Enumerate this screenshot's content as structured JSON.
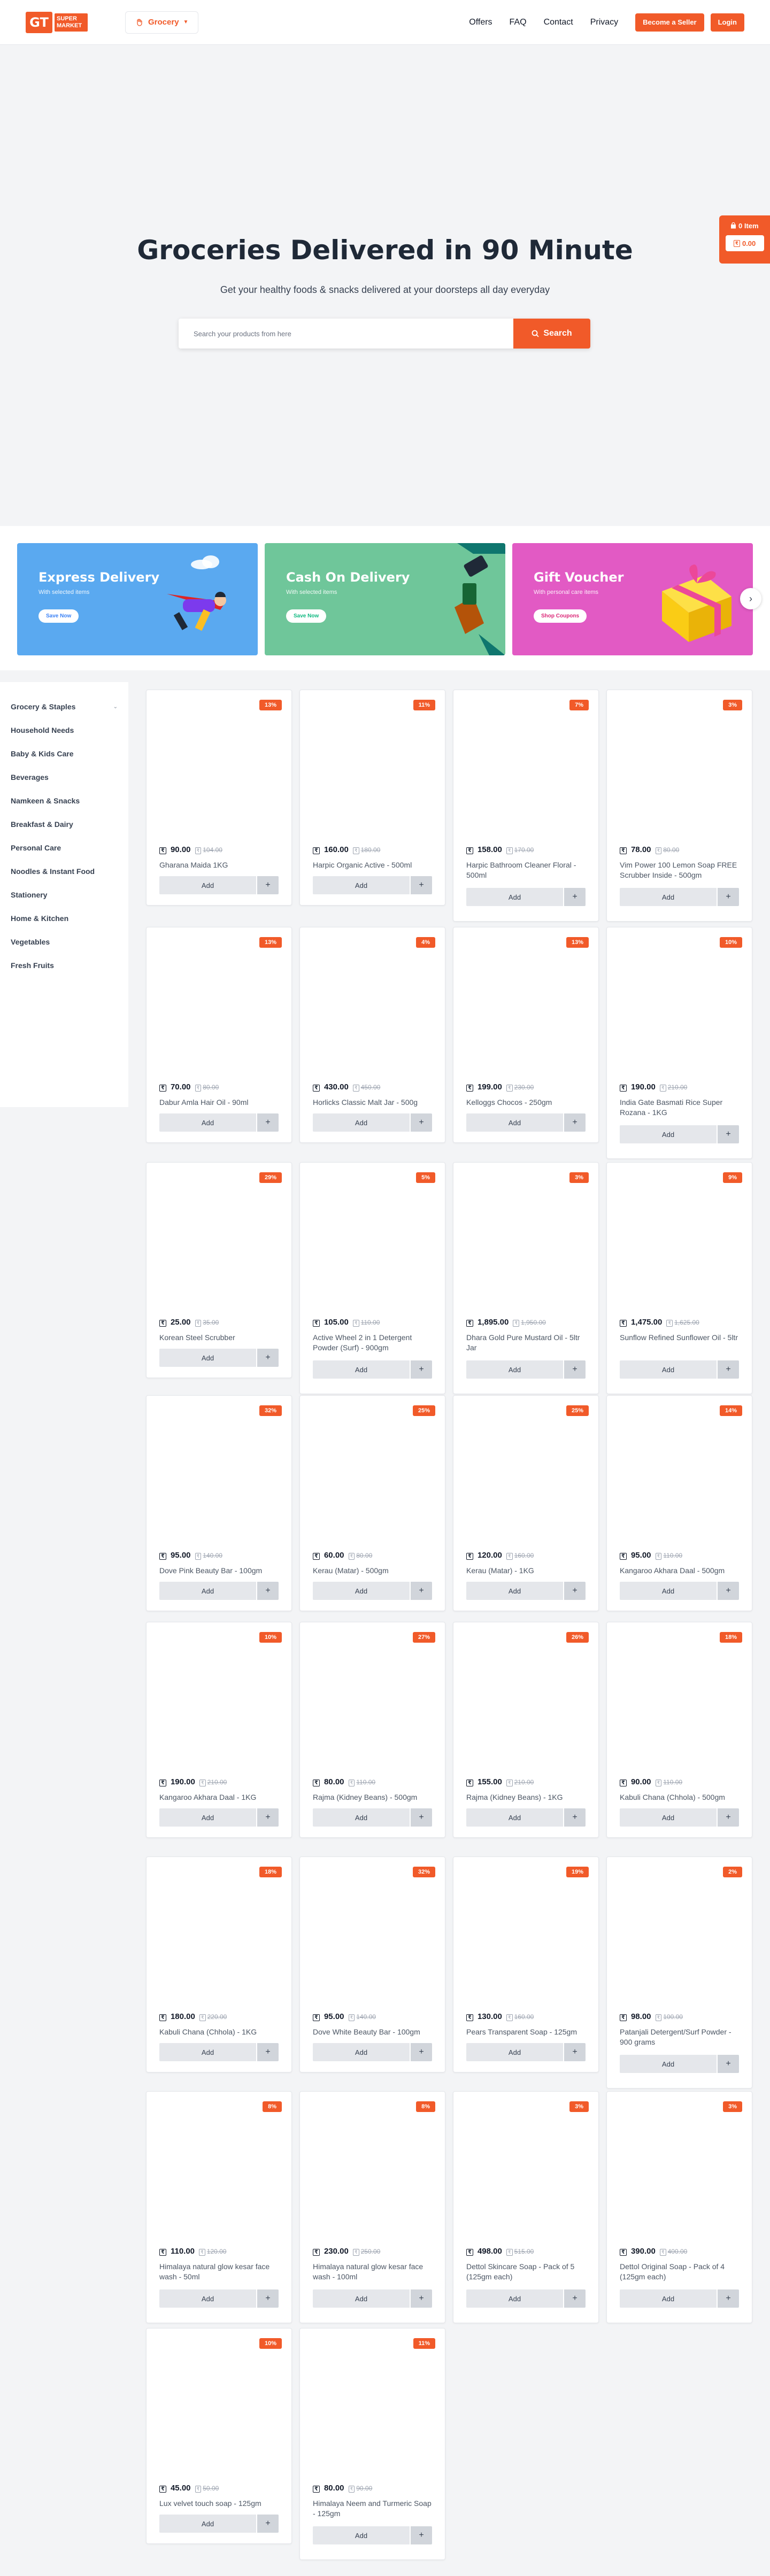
{
  "header": {
    "logo_mark": "GT",
    "logo_text": "SUPER MARKET",
    "category_selector": "Grocery",
    "nav": [
      "Offers",
      "FAQ",
      "Contact",
      "Privacy"
    ],
    "seller_button": "Become a Seller",
    "login_button": "Login"
  },
  "hero": {
    "title": "Groceries Delivered in 90 Minute",
    "subtitle": "Get your healthy foods & snacks delivered at your doorsteps all day everyday",
    "search_placeholder": "Search your products from here",
    "search_button": "Search"
  },
  "cart": {
    "items_label": "0 Item",
    "amount": "0.00",
    "currency_icon": "rupee-icon"
  },
  "promos": [
    {
      "title": "Express Delivery",
      "text": "With selected items",
      "button": "Save Now",
      "bg": "#5aa9f0",
      "accent": "#3b82f6"
    },
    {
      "title": "Cash On Delivery",
      "text": "With selected items",
      "button": "Save Now",
      "bg": "#6fc69a",
      "accent": "#10b981"
    },
    {
      "title": "Gift Voucher",
      "text": "With personal care items",
      "button": "Shop Coupons",
      "bg": "#e25ac4",
      "accent": "#db2777"
    }
  ],
  "sidebar": {
    "items": [
      "Grocery & Staples",
      "Household Needs",
      "Baby & Kids Care",
      "Beverages",
      "Namkeen & Snacks",
      "Breakfast & Dairy",
      "Personal Care",
      "Noodles & Instant Food",
      "Stationery",
      "Home & Kitchen",
      "Vegetables",
      "Fresh Fruits"
    ]
  },
  "labels": {
    "add": "Add",
    "plus": "+"
  },
  "products": [
    {
      "name": "Gharana Maida 1KG",
      "price": "90.00",
      "old": "104.00",
      "discount": "13%"
    },
    {
      "name": "Harpic Organic Active - 500ml",
      "price": "160.00",
      "old": "180.00",
      "discount": "11%"
    },
    {
      "name": "Harpic Bathroom Cleaner Floral - 500ml",
      "price": "158.00",
      "old": "170.00",
      "discount": "7%"
    },
    {
      "name": "Vim Power 100 Lemon Soap FREE Scrubber Inside - 500gm",
      "price": "78.00",
      "old": "80.00",
      "discount": "3%"
    },
    {
      "name": "Dabur Amla Hair Oil - 90ml",
      "price": "70.00",
      "old": "80.00",
      "discount": "13%"
    },
    {
      "name": "Horlicks Classic Malt Jar - 500g",
      "price": "430.00",
      "old": "450.00",
      "discount": "4%"
    },
    {
      "name": "Kelloggs Chocos - 250gm",
      "price": "199.00",
      "old": "230.00",
      "discount": "13%"
    },
    {
      "name": "India Gate Basmati Rice Super Rozana - 1KG",
      "price": "190.00",
      "old": "210.00",
      "discount": "10%"
    },
    {
      "name": "Korean Steel Scrubber",
      "price": "25.00",
      "old": "35.00",
      "discount": "29%"
    },
    {
      "name": "Active Wheel 2 in 1 Detergent Powder (Surf) - 900gm",
      "price": "105.00",
      "old": "110.00",
      "discount": "5%"
    },
    {
      "name": "Dhara Gold Pure Mustard Oil - 5ltr Jar",
      "price": "1,895.00",
      "old": "1,950.00",
      "discount": "3%"
    },
    {
      "name": "Sunflow Refined Sunflower Oil - 5ltr",
      "price": "1,475.00",
      "old": "1,625.00",
      "discount": "9%"
    },
    {
      "name": "Dove Pink Beauty Bar - 100gm",
      "price": "95.00",
      "old": "140.00",
      "discount": "32%"
    },
    {
      "name": "Kerau (Matar) - 500gm",
      "price": "60.00",
      "old": "80.00",
      "discount": "25%"
    },
    {
      "name": "Kerau (Matar) - 1KG",
      "price": "120.00",
      "old": "160.00",
      "discount": "25%"
    },
    {
      "name": "Kangaroo Akhara Daal - 500gm",
      "price": "95.00",
      "old": "110.00",
      "discount": "14%"
    },
    {
      "name": "Kangaroo Akhara Daal - 1KG",
      "price": "190.00",
      "old": "210.00",
      "discount": "10%"
    },
    {
      "name": "Rajma (Kidney Beans) - 500gm",
      "price": "80.00",
      "old": "110.00",
      "discount": "27%"
    },
    {
      "name": "Rajma (Kidney Beans) - 1KG",
      "price": "155.00",
      "old": "210.00",
      "discount": "26%"
    },
    {
      "name": "Kabuli Chana (Chhola) - 500gm",
      "price": "90.00",
      "old": "110.00",
      "discount": "18%"
    },
    {
      "name": "Kabuli Chana (Chhola) - 1KG",
      "price": "180.00",
      "old": "220.00",
      "discount": "18%"
    },
    {
      "name": "Dove White Beauty Bar - 100gm",
      "price": "95.00",
      "old": "140.00",
      "discount": "32%"
    },
    {
      "name": "Pears Transparent Soap - 125gm",
      "price": "130.00",
      "old": "160.00",
      "discount": "19%"
    },
    {
      "name": "Patanjali Detergent/Surf Powder - 900 grams",
      "price": "98.00",
      "old": "100.00",
      "discount": "2%"
    },
    {
      "name": "Himalaya natural glow kesar face wash - 50ml",
      "price": "110.00",
      "old": "120.00",
      "discount": "8%"
    },
    {
      "name": "Himalaya natural glow kesar face wash - 100ml",
      "price": "230.00",
      "old": "250.00",
      "discount": "8%"
    },
    {
      "name": "Dettol Skincare Soap - Pack of 5 (125gm each)",
      "price": "498.00",
      "old": "515.00",
      "discount": "3%"
    },
    {
      "name": "Dettol Original Soap - Pack of 4 (125gm each)",
      "price": "390.00",
      "old": "400.00",
      "discount": "3%"
    },
    {
      "name": "Lux velvet touch soap - 125gm",
      "price": "45.00",
      "old": "50.00",
      "discount": "10%"
    },
    {
      "name": "Himalaya Neem and Turmeric Soap - 125gm",
      "price": "80.00",
      "old": "90.00",
      "discount": "11%"
    }
  ]
}
